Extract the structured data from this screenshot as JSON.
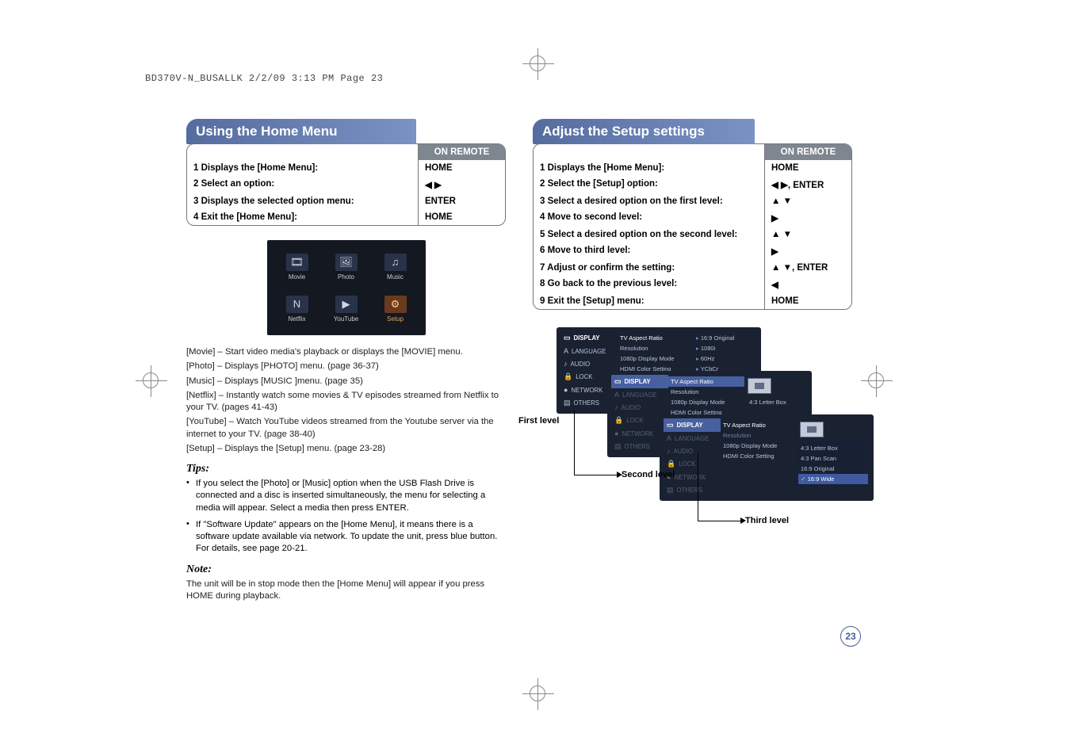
{
  "page_ref": "BD370V-N_BUSALLK  2/2/09  3:13 PM  Page 23",
  "page_number": "23",
  "left": {
    "title": "Using the Home Menu",
    "on_remote_label": "ON REMOTE",
    "steps": [
      {
        "n": "1",
        "label": "Displays the [Home Menu]:",
        "key": "HOME"
      },
      {
        "n": "2",
        "label": "Select an option:",
        "key": "◀ ▶"
      },
      {
        "n": "3",
        "label": "Displays the selected option menu:",
        "key": "ENTER"
      },
      {
        "n": "4",
        "label": "Exit the [Home Menu]:",
        "key": "HOME"
      }
    ],
    "home_cells": [
      {
        "icon": "🎞",
        "label": "Movie"
      },
      {
        "icon": "🖼",
        "label": "Photo"
      },
      {
        "icon": "♫",
        "label": "Music"
      },
      {
        "icon": "N",
        "label": "Netflix"
      },
      {
        "icon": "▶",
        "label": "YouTube"
      },
      {
        "icon": "⚙",
        "label": "Setup"
      }
    ],
    "desc": [
      "[Movie] – Start video media's playback or displays the [MOVIE] menu.",
      "[Photo] – Displays [PHOTO] menu. (page 36-37)",
      "[Music] – Displays [MUSIC ]menu. (page 35)",
      "[Netflix] – Instantly watch some movies & TV episodes streamed from Netflix to your TV. (pages 41-43)",
      "[YouTube] – Watch YouTube videos streamed from the Youtube server via the internet to your TV. (page 38-40)",
      "[Setup] – Displays the [Setup] menu. (page 23-28)"
    ],
    "tips_label": "Tips:",
    "tips": [
      "If you select the [Photo] or [Music] option when the USB Flash Drive is connected and a disc is inserted simultaneously, the menu for selecting a media will appear. Select a media then press ENTER.",
      "If \"Software Update\" appears on the [Home Menu], it means there is a software update available via network. To update the unit, press blue button. For details, see page 20-21."
    ],
    "note_label": "Note:",
    "note": "The unit will be in stop mode then the [Home Menu] will appear if you press HOME during playback."
  },
  "right": {
    "title": "Adjust the Setup settings",
    "on_remote_label": "ON REMOTE",
    "steps": [
      {
        "n": "1",
        "label": "Displays the [Home Menu]:",
        "key": "HOME"
      },
      {
        "n": "2",
        "label": "Select the [Setup] option:",
        "key": "◀ ▶, ENTER"
      },
      {
        "n": "3",
        "label": "Select a desired option on the first level:",
        "key": "▲ ▼"
      },
      {
        "n": "4",
        "label": "Move to second level:",
        "key": "▶"
      },
      {
        "n": "5",
        "label": "Select a desired option on the second level:",
        "key": "▲ ▼"
      },
      {
        "n": "6",
        "label": "Move to third level:",
        "key": "▶"
      },
      {
        "n": "7",
        "label": "Adjust or confirm the setting:",
        "key": "▲ ▼, ENTER"
      },
      {
        "n": "8",
        "label": "Go back to the previous level:",
        "key": "◀"
      },
      {
        "n": "9",
        "label": "Exit the [Setup] menu:",
        "key": "HOME"
      }
    ],
    "level_first": "First level",
    "level_second": "Second level",
    "level_third": "Third level",
    "panel_side": [
      "DISPLAY",
      "LANGUAGE",
      "AUDIO",
      "LOCK",
      "NETWORK",
      "OTHERS"
    ],
    "panel_icons": [
      "▭",
      "A",
      "♪",
      "🔒",
      "●",
      "▤"
    ],
    "panel_mid": [
      {
        "t": "TV Aspect Ratio",
        "r": "▸",
        "v": "16:9 Original"
      },
      {
        "t": "Resolution",
        "r": "▸",
        "v": "1080i"
      },
      {
        "t": "1080p Display Mode",
        "r": "▸",
        "v": "60Hz"
      },
      {
        "t": "HDMI Color Setting",
        "r": "▸",
        "v": "YCbCr"
      }
    ],
    "panel2_mid": [
      "TV Aspect Ratio",
      "Resolution",
      "1080p Display Mode",
      "HDMI Color Setting"
    ],
    "panel2_end": "4:3 Letter Box",
    "panel3_mid": [
      "TV Aspect Ratio",
      "Resolution",
      "1080p Display Mode",
      "HDMI Color Setting"
    ],
    "panel3_opts": [
      "4:3 Letter Box",
      "4:3 Pan Scan",
      "16:9 Original",
      "16:9 Wide"
    ]
  }
}
